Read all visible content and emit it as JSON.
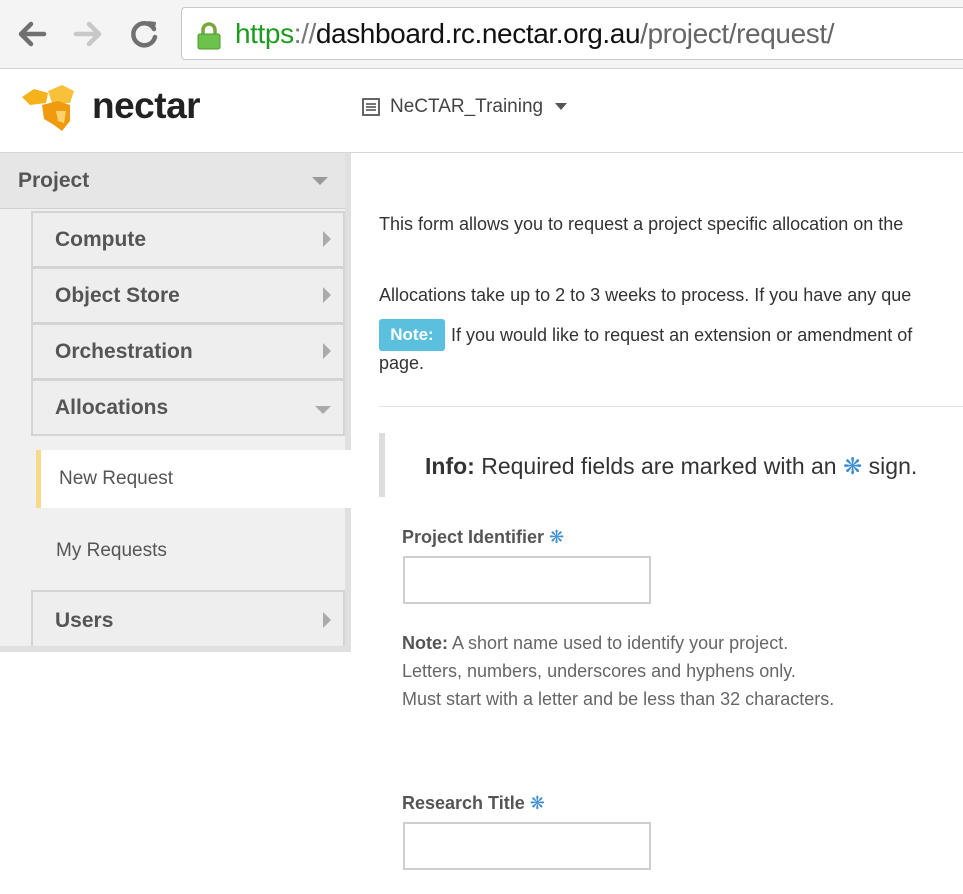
{
  "browser": {
    "url_scheme": "https",
    "url_sep": "://",
    "url_host": "dashboard.rc.nectar.org.au",
    "url_path": "/project/request/"
  },
  "header": {
    "logo_text": "nectar",
    "project_name": "NeCTAR_Training"
  },
  "sidebar": {
    "section": "Project",
    "panels": {
      "compute": "Compute",
      "object_store": "Object Store",
      "orchestration": "Orchestration",
      "allocations": "Allocations",
      "users": "Users"
    },
    "subitems": {
      "new_request": "New Request",
      "my_requests": "My Requests"
    }
  },
  "main": {
    "intro": "This form allows you to request a project specific allocation on the",
    "process": "Allocations take up to 2 to 3 weeks to process. If you have any que",
    "note_badge": "Note:",
    "note_text": "If you would like to request an extension or amendment of",
    "note_tail": "page.",
    "info_label": "Info:",
    "info_text_before": "Required fields are marked with an",
    "info_text_after": "sign.",
    "star": "❋"
  },
  "form": {
    "project_identifier": {
      "label": "Project Identifier",
      "value": "",
      "note_label": "Note:",
      "note_line1": "A short name used to identify your project.",
      "note_line2": "Letters, numbers, underscores and hyphens only.",
      "note_line3": "Must start with a letter and be less than 32 characters."
    },
    "research_title": {
      "label": "Research Title",
      "value": ""
    }
  },
  "colors": {
    "accent_blue": "#3f8fd2",
    "note_badge": "#5bc0de",
    "active_border": "#f7d98a",
    "url_green": "#1e9a1e"
  }
}
